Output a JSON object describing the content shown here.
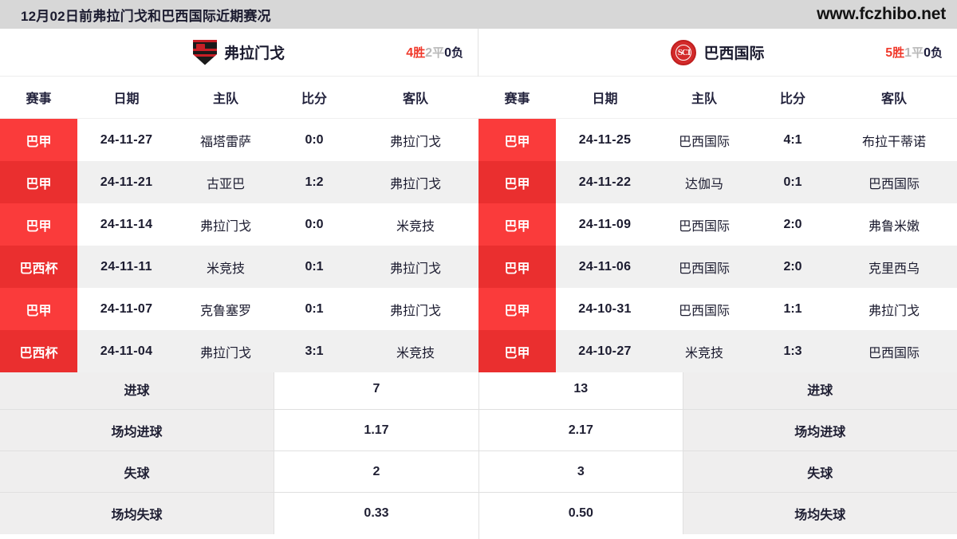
{
  "topbar": {
    "title": "12月02日前弗拉门戈和巴西国际近期赛况",
    "site": "www.fczhibo.net"
  },
  "columns": {
    "league": "赛事",
    "date": "日期",
    "home": "主队",
    "score": "比分",
    "away": "客队"
  },
  "left": {
    "team": "弗拉门戈",
    "logo": "flamengo-crest-icon",
    "record": {
      "wins": "4",
      "win_unit": "胜",
      "draws": "2",
      "draw_unit": "平",
      "losses": "0",
      "lose_unit": "负"
    },
    "matches": [
      {
        "league": "巴甲",
        "date": "24-11-27",
        "home": "福塔雷萨",
        "score": "0:0",
        "away": "弗拉门戈"
      },
      {
        "league": "巴甲",
        "date": "24-11-21",
        "home": "古亚巴",
        "score": "1:2",
        "away": "弗拉门戈"
      },
      {
        "league": "巴甲",
        "date": "24-11-14",
        "home": "弗拉门戈",
        "score": "0:0",
        "away": "米竞技"
      },
      {
        "league": "巴西杯",
        "date": "24-11-11",
        "home": "米竞技",
        "score": "0:1",
        "away": "弗拉门戈"
      },
      {
        "league": "巴甲",
        "date": "24-11-07",
        "home": "克鲁塞罗",
        "score": "0:1",
        "away": "弗拉门戈"
      },
      {
        "league": "巴西杯",
        "date": "24-11-04",
        "home": "弗拉门戈",
        "score": "3:1",
        "away": "米竞技"
      }
    ],
    "stats": [
      {
        "label": "进球",
        "value": "7"
      },
      {
        "label": "场均进球",
        "value": "1.17"
      },
      {
        "label": "失球",
        "value": "2"
      },
      {
        "label": "场均失球",
        "value": "0.33"
      }
    ]
  },
  "right": {
    "team": "巴西国际",
    "logo": "internacional-crest-icon",
    "logo_monogram": "SCI",
    "record": {
      "wins": "5",
      "win_unit": "胜",
      "draws": "1",
      "draw_unit": "平",
      "losses": "0",
      "lose_unit": "负"
    },
    "matches": [
      {
        "league": "巴甲",
        "date": "24-11-25",
        "home": "巴西国际",
        "score": "4:1",
        "away": "布拉干蒂诺"
      },
      {
        "league": "巴甲",
        "date": "24-11-22",
        "home": "达伽马",
        "score": "0:1",
        "away": "巴西国际"
      },
      {
        "league": "巴甲",
        "date": "24-11-09",
        "home": "巴西国际",
        "score": "2:0",
        "away": "弗鲁米嫩"
      },
      {
        "league": "巴甲",
        "date": "24-11-06",
        "home": "巴西国际",
        "score": "2:0",
        "away": "克里西乌"
      },
      {
        "league": "巴甲",
        "date": "24-10-31",
        "home": "巴西国际",
        "score": "1:1",
        "away": "弗拉门戈"
      },
      {
        "league": "巴甲",
        "date": "24-10-27",
        "home": "米竞技",
        "score": "1:3",
        "away": "巴西国际"
      }
    ],
    "stats": [
      {
        "label": "进球",
        "value": "13"
      },
      {
        "label": "场均进球",
        "value": "2.17"
      },
      {
        "label": "失球",
        "value": "3"
      },
      {
        "label": "场均失球",
        "value": "0.50"
      }
    ]
  },
  "colors": {
    "topbar_bg": "#d7d7d7",
    "league_badge_odd": "#fa3b3b",
    "league_badge_even": "#ea2f2f",
    "row_even_bg": "#f0f0f0",
    "win_text": "#f0392b",
    "draw_text": "#b9b9b9",
    "lose_text": "#1b1b3a",
    "stat_label_bg": "#efeeee"
  }
}
